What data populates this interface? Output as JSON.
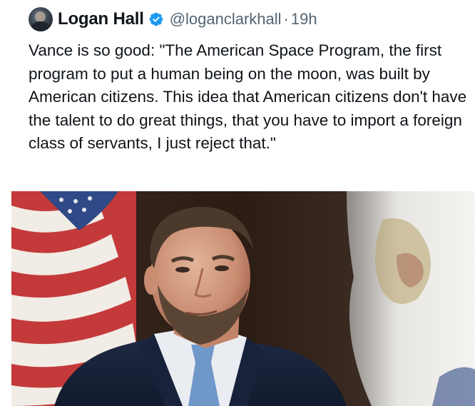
{
  "post": {
    "author_name": "Logan Hall",
    "handle": "@loganclarkhall",
    "separator": "·",
    "timestamp": "19h",
    "text": "Vance is so good: \"The American Space Program, the first program to put a human being on the moon, was built by American citizens. This idea that American citizens don't have the talent to do great things, that you have to import a foreign class of servants, I just reject that.\"",
    "verified_icon": "verified-badge-icon",
    "avatar_icon": "avatar",
    "media_icon": "photo-man-in-suit-with-flags"
  },
  "colors": {
    "verified_badge": "#1d9bf0",
    "name_text": "#0f1419",
    "secondary_text": "#536471"
  }
}
